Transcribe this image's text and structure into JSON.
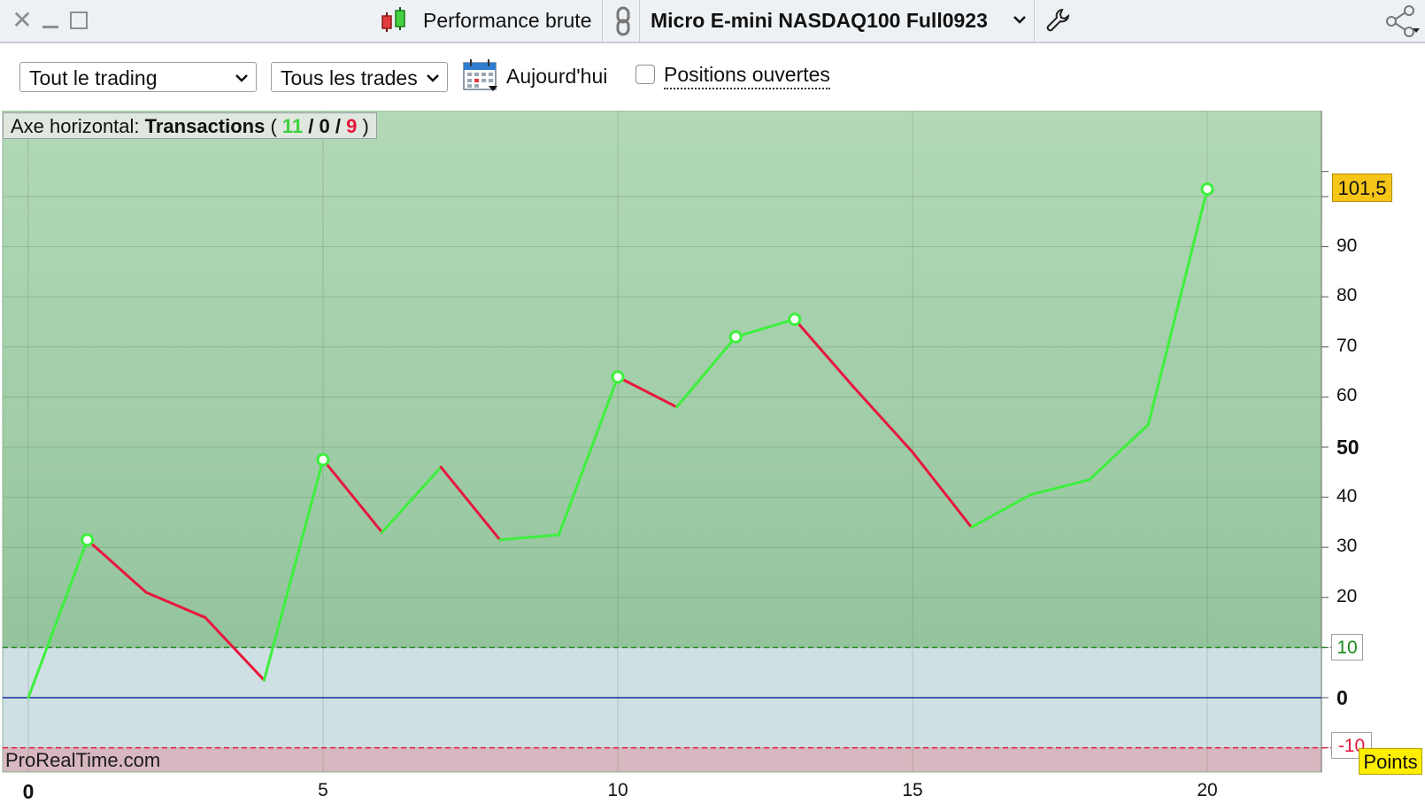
{
  "window": {
    "close_icon": "close-icon",
    "minimize_icon": "minimize-icon",
    "maximize_icon": "maximize-icon",
    "report_title": "Performance brute",
    "instrument": "Micro E-mini NASDAQ100 Full0923"
  },
  "toolbar": {
    "scope_value": "Tout le trading",
    "trades_value": "Tous les trades",
    "today_label": "Aujourd'hui",
    "open_positions_label": "Positions ouvertes",
    "open_positions_checked": false
  },
  "chart": {
    "axis_caption_prefix": "Axe horizontal: ",
    "axis_caption_name": "Transactions",
    "open_paren": " ( ",
    "wins": "11",
    "slash": " / ",
    "neutral": "0",
    "losses": "9",
    "close_paren": " )",
    "watermark": "ProRealTime.com",
    "last_value_label": "101,5",
    "upper_threshold_label": "10",
    "lower_threshold_label": "-10",
    "units_label": "Points",
    "colors": {
      "gain": "#3df03d",
      "loss": "#e8173d",
      "zero_line": "#1a2aa0",
      "profit_zone": "#a8d4ac",
      "neutral_zone": "#cfe0e4",
      "loss_zone": "#d8b8c0"
    }
  },
  "chart_data": {
    "type": "line",
    "xlabel": "Transactions",
    "x": [
      0,
      1,
      2,
      3,
      4,
      5,
      6,
      7,
      8,
      9,
      10,
      11,
      12,
      13,
      14,
      15,
      16,
      17,
      18,
      19,
      20
    ],
    "y": [
      0,
      31.5,
      21,
      16,
      3.5,
      47.5,
      33,
      46,
      31.5,
      32.5,
      64,
      58,
      72,
      75.5,
      62,
      49,
      34,
      40.5,
      43.5,
      54.5,
      101.5
    ],
    "x_ticks": [
      "0",
      "5",
      "10",
      "15",
      "20"
    ],
    "y_ticks": [
      "-10",
      "0",
      "10",
      "20",
      "30",
      "40",
      "50",
      "60",
      "70",
      "80",
      "90"
    ],
    "xlim": [
      -0.5,
      22
    ],
    "ylim": [
      -15,
      111
    ],
    "threshold_upper": 10,
    "threshold_lower": -10,
    "grid": true,
    "marked_highs": [
      1,
      5,
      10,
      12,
      13,
      20
    ]
  }
}
